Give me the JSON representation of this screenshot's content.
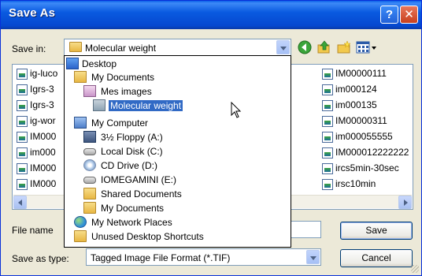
{
  "window": {
    "title": "Save As",
    "help_glyph": "?",
    "close_glyph": "✕"
  },
  "save_in": {
    "label": "Save in:",
    "current": "Molecular weight"
  },
  "toolbar": {
    "back": "back-icon",
    "up": "up-folder-icon",
    "new_folder": "new-folder-icon",
    "views": "views-menu-icon"
  },
  "files_left": [
    "ig-luco",
    "Igrs-3",
    "Igrs-3",
    "ig-wor",
    "IM000",
    "im000",
    "IM000",
    "IM000"
  ],
  "files_right": [
    "IM00000111",
    "im000124",
    "im000135",
    "IM00000311",
    "im000055555",
    "IM000012222222",
    "ircs5min-30sec",
    "irsc10min"
  ],
  "dropdown_items": [
    {
      "label": "Desktop",
      "icon": "desktop-icon"
    },
    {
      "label": "My Documents",
      "icon": "my-documents-icon"
    },
    {
      "label": "Mes images",
      "icon": "pictures-folder-icon"
    },
    {
      "label": "Molecular weight",
      "icon": "open-folder-icon",
      "selected": true
    },
    {
      "label": "My Computer",
      "icon": "my-computer-icon"
    },
    {
      "label": "3½ Floppy (A:)",
      "icon": "floppy-drive-icon"
    },
    {
      "label": "Local Disk (C:)",
      "icon": "hard-disk-icon"
    },
    {
      "label": "CD Drive (D:)",
      "icon": "cd-drive-icon"
    },
    {
      "label": "IOMEGAMINI (E:)",
      "icon": "removable-drive-icon"
    },
    {
      "label": "Shared Documents",
      "icon": "folder-icon"
    },
    {
      "label": "My Documents",
      "icon": "folder-icon"
    },
    {
      "label": "My Network Places",
      "icon": "network-places-icon"
    },
    {
      "label": "Unused Desktop Shortcuts",
      "icon": "folder-icon"
    }
  ],
  "file_name": {
    "label": "File name",
    "value": ""
  },
  "save_as_type": {
    "label": "Save as type:",
    "value": "Tagged Image File Format (*.TIF)"
  },
  "buttons": {
    "save": "Save",
    "cancel": "Cancel"
  }
}
